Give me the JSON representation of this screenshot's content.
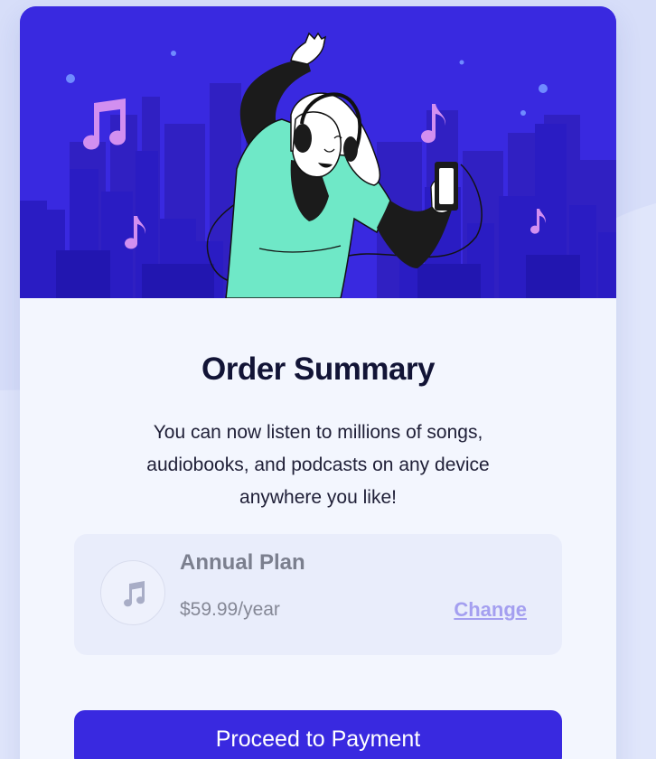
{
  "colors": {
    "page_background": "#e0e6fb",
    "card_background": "#f3f6fe",
    "hero_background": "#3929e0",
    "accent": "#3929e0",
    "title_text": "#121436",
    "plan_box_background": "#e9edfb",
    "change_link": "#a49ff0"
  },
  "hero": {
    "icon": "person-dancing-with-headphones-illustration"
  },
  "summary": {
    "title": "Order Summary",
    "description": "You can now listen to millions of songs, audiobooks, and podcasts on any device anywhere you like!"
  },
  "plan": {
    "icon": "music-note-icon",
    "name": "Annual Plan",
    "price": "$59.99/year",
    "change_label": "Change"
  },
  "actions": {
    "proceed_label": "Proceed to Payment"
  }
}
